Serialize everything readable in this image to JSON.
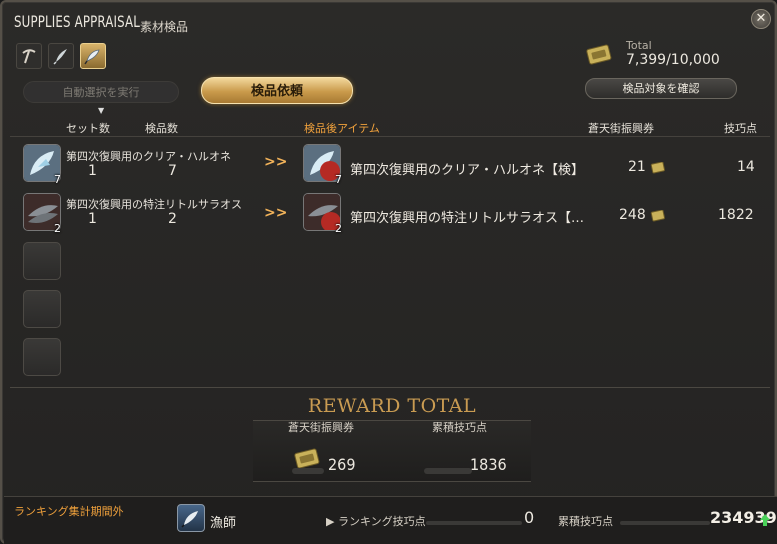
{
  "window": {
    "title_en": "SUPPLIES APPRAISAL",
    "title_jp": "素材検品"
  },
  "icons": {
    "close": "close-icon",
    "tabs": [
      "pickaxe-icon",
      "quill-icon",
      "fish-icon"
    ],
    "scrip": "scrip-icon",
    "job": "fisher-icon",
    "up": "up-arrow-icon"
  },
  "colors": {
    "accent_orange": "#f0a13c",
    "gold_button": "#c99a4b",
    "reward_title": "#c99b52",
    "up_arrow": "#4bd35a"
  },
  "total": {
    "label": "Total",
    "value": "7,399/10,000"
  },
  "buttons": {
    "auto_select": "自動選択を実行",
    "request": "検品依頼",
    "confirm_targets": "検品対象を確認"
  },
  "columns": {
    "set_count": "セット数",
    "inspect_count": "検品数",
    "result_item": "検品後アイテム",
    "scrip": "蒼天街振興券",
    "skill_points": "技巧点"
  },
  "rows": [
    {
      "name": "第四次復興用のクリア・ハルオネ",
      "icon_qty": "7",
      "set_count": "1",
      "inspect_count": "7",
      "arrow": "»",
      "result_name": "第四次復興用のクリア・ハルオネ【検】",
      "result_qty": "7",
      "scrip": "21",
      "skill": "14"
    },
    {
      "name": "第四次復興用の特注リトルサラオス",
      "icon_qty": "2",
      "set_count": "1",
      "inspect_count": "2",
      "arrow": "»",
      "result_name": "第四次復興用の特注リトルサラオス【…",
      "result_qty": "2",
      "scrip": "248",
      "skill": "1822"
    }
  ],
  "reward": {
    "title": "REWARD TOTAL",
    "scrip_label": "蒼天街振興券",
    "skill_label": "累積技巧点",
    "scrip_value": "269",
    "skill_value": "1836"
  },
  "footer": {
    "ranking_status": "ランキング集計期間外",
    "job": "漁師",
    "ranking_label": "▶ ランキング技巧点",
    "ranking_value": "0",
    "cumulative_label": "累積技巧点",
    "cumulative_value": "234939"
  }
}
